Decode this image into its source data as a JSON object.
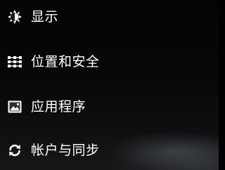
{
  "settings_menu": {
    "items": [
      {
        "label": "显示",
        "icon": "display-brightness-icon"
      },
      {
        "label": "位置和安全",
        "icon": "location-security-grid-icon"
      },
      {
        "label": "应用程序",
        "icon": "applications-icon"
      },
      {
        "label": "帐户与同步",
        "icon": "sync-icon"
      }
    ]
  },
  "colors": {
    "text": "#ffffff",
    "background": "#050607"
  }
}
